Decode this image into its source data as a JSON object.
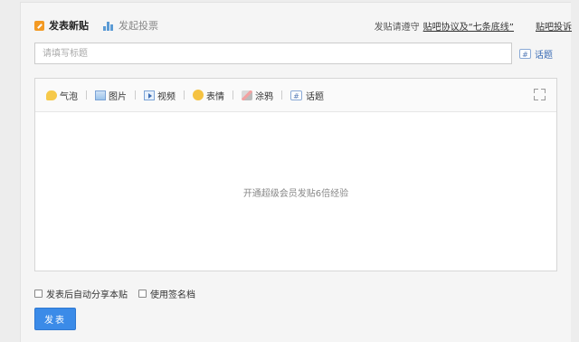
{
  "tabs": {
    "new_post": "发表新贴",
    "poll": "发起投票"
  },
  "header_right": {
    "notice_prefix": "发贴请遵守",
    "rules_link": "贴吧协议及“七条底线”",
    "complaint_link": "贴吧投诉"
  },
  "title_input": {
    "placeholder": "请填写标题",
    "value": ""
  },
  "topic_button": {
    "label": "话题"
  },
  "toolbar": {
    "items": [
      {
        "label": "气泡",
        "icon": "speech-bubble-icon"
      },
      {
        "label": "图片",
        "icon": "image-icon"
      },
      {
        "label": "视频",
        "icon": "video-icon"
      },
      {
        "label": "表情",
        "icon": "smiley-icon"
      },
      {
        "label": "涂鸦",
        "icon": "brush-icon"
      },
      {
        "label": "话题",
        "icon": "hashtag-icon"
      }
    ],
    "expand_icon": "fullscreen-icon"
  },
  "editor": {
    "placeholder": "开通超级会员发贴6倍经验"
  },
  "options": {
    "auto_share": "发表后自动分享本贴",
    "use_signature": "使用签名档"
  },
  "submit": {
    "label": "发表"
  },
  "colors": {
    "accent": "#3b8be8",
    "link": "#3c6db5",
    "edit_icon": "#f39a24"
  }
}
